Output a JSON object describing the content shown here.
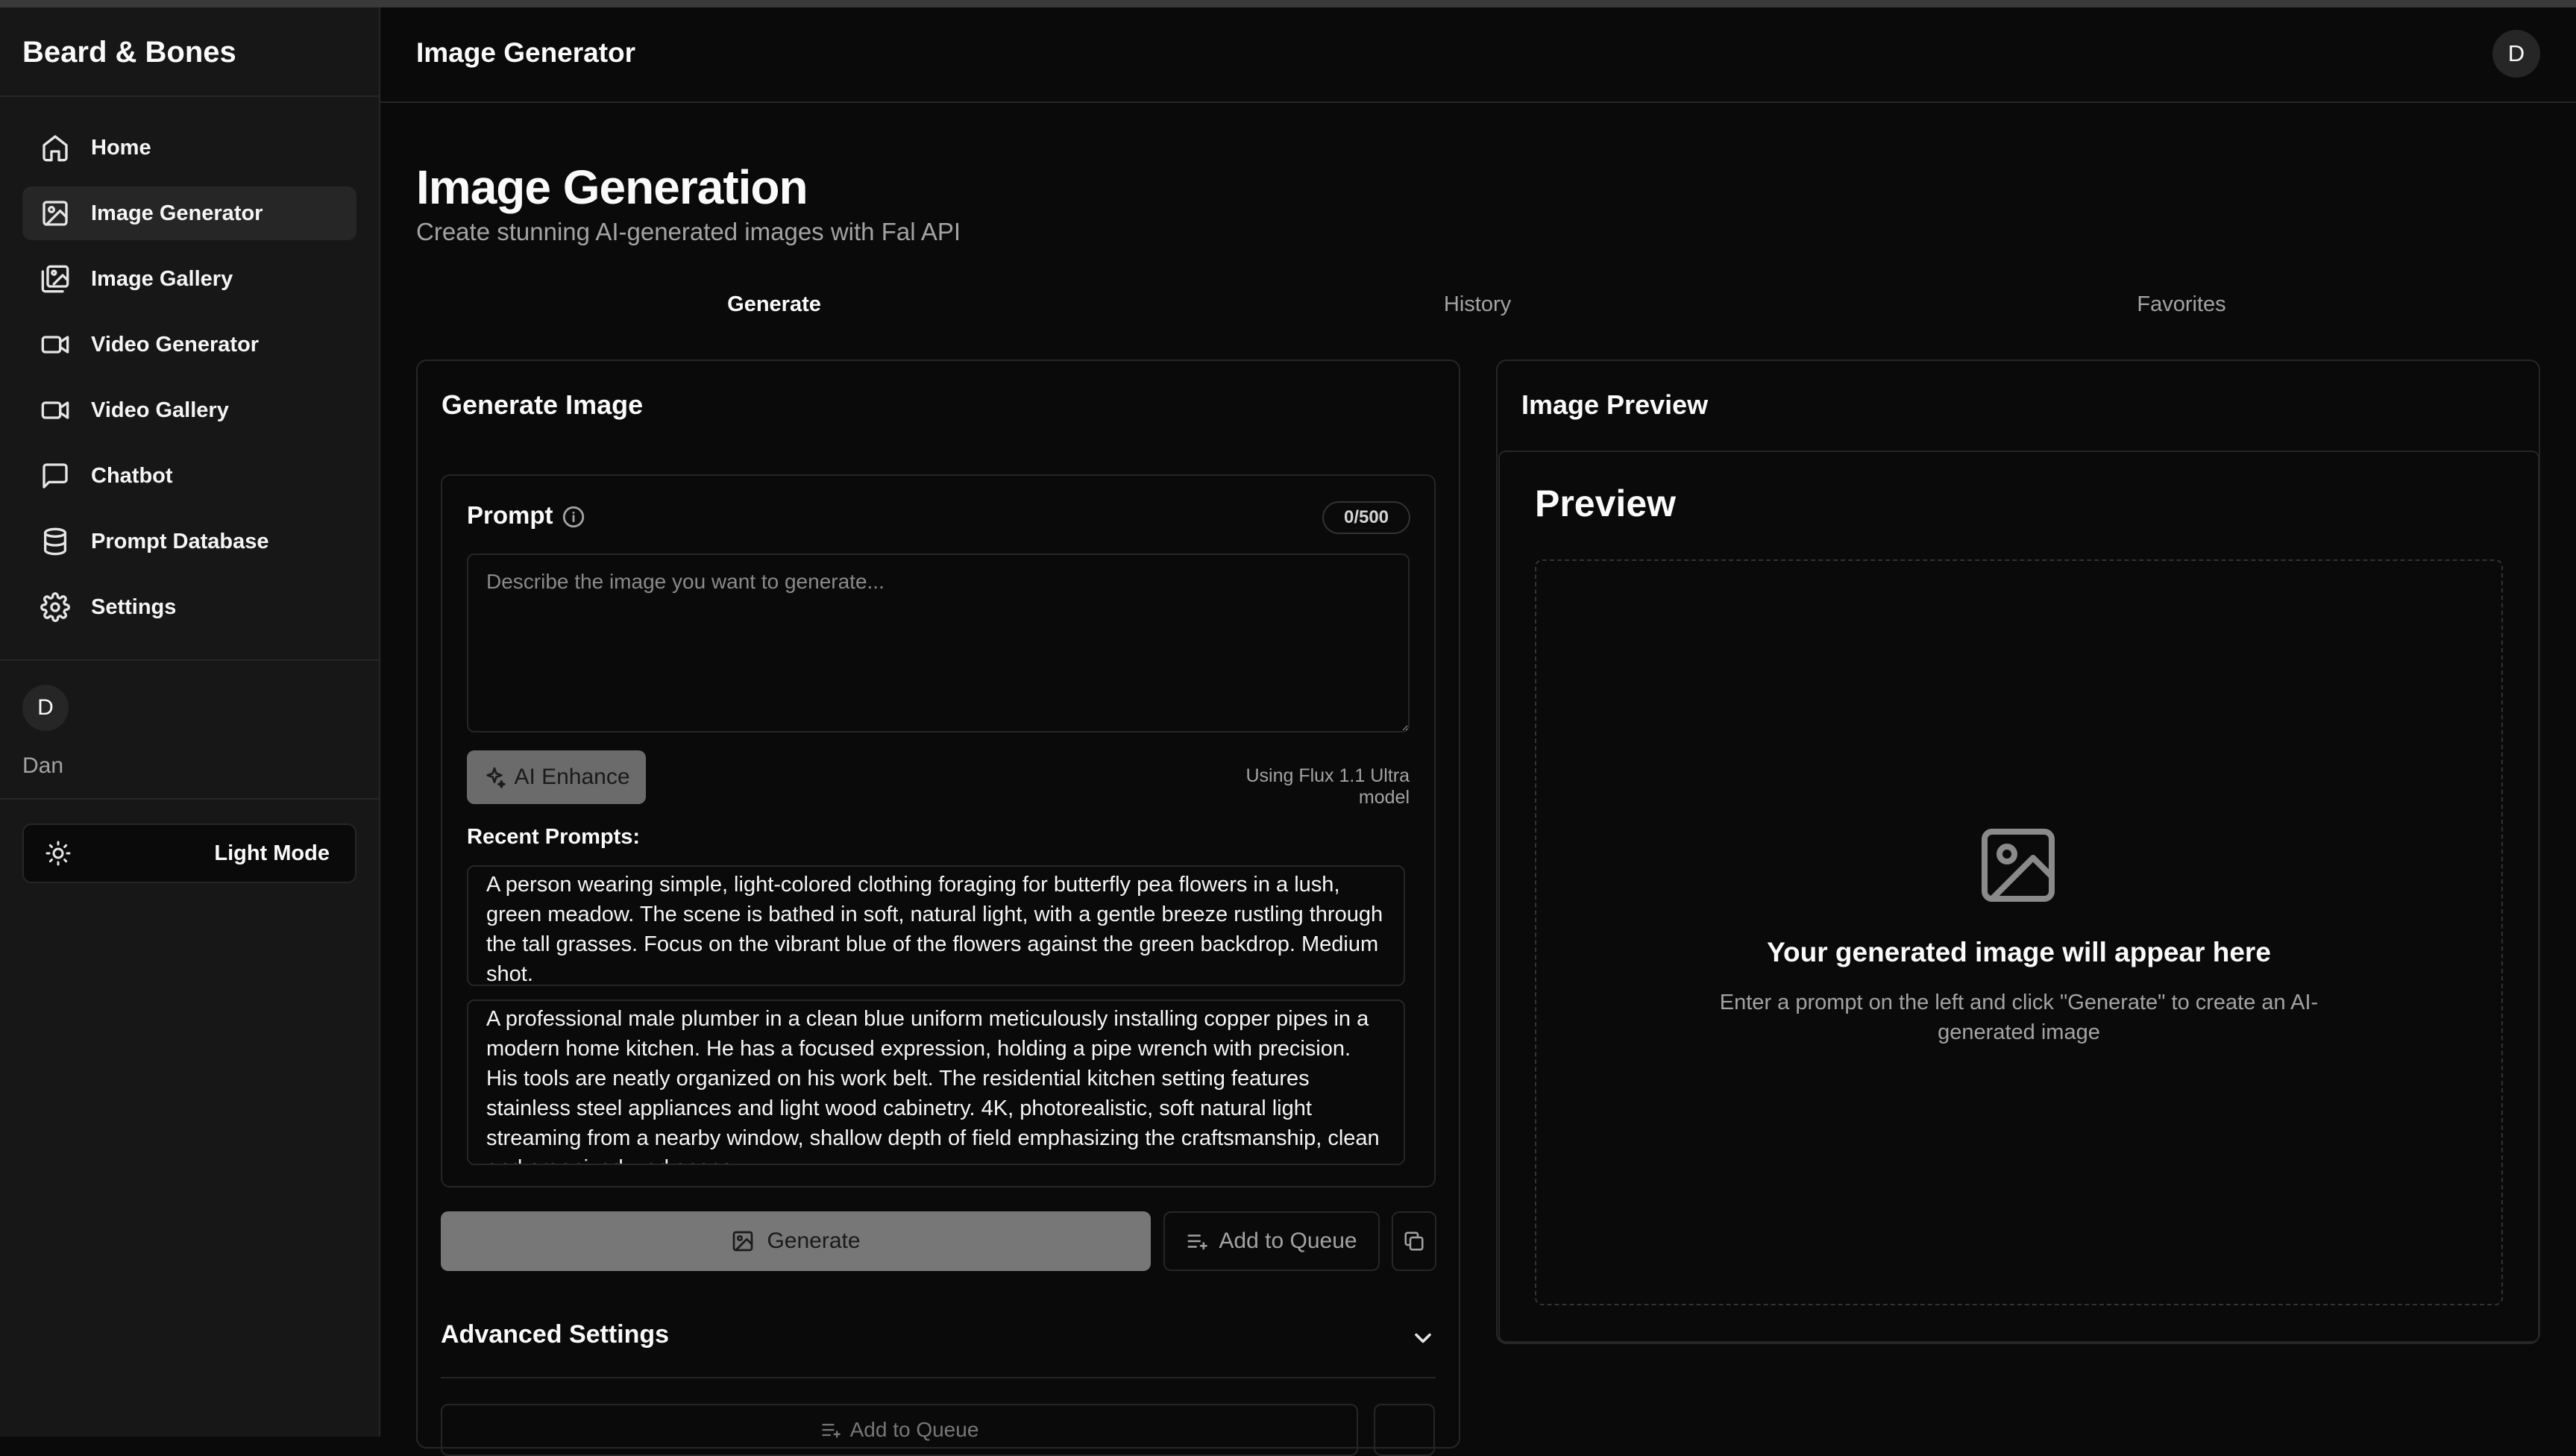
{
  "app": {
    "brand": "Beard & Bones"
  },
  "sidebar": {
    "items": [
      {
        "label": "Home",
        "icon": "home-icon",
        "active": false
      },
      {
        "label": "Image Generator",
        "icon": "image-icon",
        "active": true
      },
      {
        "label": "Image Gallery",
        "icon": "images-icon",
        "active": false
      },
      {
        "label": "Video Generator",
        "icon": "video-icon",
        "active": false
      },
      {
        "label": "Video Gallery",
        "icon": "video-icon",
        "active": false
      },
      {
        "label": "Chatbot",
        "icon": "chat-icon",
        "active": false
      },
      {
        "label": "Prompt Database",
        "icon": "database-icon",
        "active": false
      },
      {
        "label": "Settings",
        "icon": "gear-icon",
        "active": false
      }
    ],
    "user": {
      "initial": "D",
      "name": "Dan"
    },
    "mode_toggle": {
      "label": "Light Mode",
      "icon": "sun-icon"
    }
  },
  "header": {
    "title": "Image Generator",
    "avatar_initial": "D"
  },
  "page": {
    "title": "Image Generation",
    "subtitle": "Create stunning AI-generated images with Fal API"
  },
  "tabs": [
    {
      "label": "Generate",
      "active": true
    },
    {
      "label": "History",
      "active": false
    },
    {
      "label": "Favorites",
      "active": false
    }
  ],
  "generate_card": {
    "title": "Generate Image",
    "prompt_label": "Prompt",
    "counter": "0/500",
    "placeholder": "Describe the image you want to generate...",
    "value": "",
    "enhance_label": "AI Enhance",
    "model_note": "Using Flux 1.1 Ultra model",
    "recent_label": "Recent Prompts:",
    "recent_prompts": [
      "A person wearing simple, light-colored clothing foraging for butterfly pea flowers in a lush, green meadow. The scene is bathed in soft, natural light, with a gentle breeze rustling through the tall grasses. Focus on the vibrant blue of the flowers against the green backdrop. Medium shot.",
      "A professional male plumber in a clean blue uniform meticulously installing copper pipes in a modern home kitchen. He has a focused expression, holding a pipe wrench with precision. His tools are neatly organized on his work belt. The residential kitchen setting features stainless steel appliances and light wood cabinetry. 4K, photorealistic, soft natural light streaming from a nearby window, shallow depth of field emphasizing the craftsmanship, clean and organized workspace."
    ],
    "generate_label": "Generate",
    "queue_label": "Add to Queue",
    "advanced_label": "Advanced Settings",
    "ghost_queue_label": "Add to Queue"
  },
  "preview_card": {
    "title": "Image Preview",
    "heading": "Preview",
    "empty_title": "Your generated image will appear here",
    "empty_desc": "Enter a prompt on the left and click \"Generate\" to create an AI-generated image"
  },
  "colors": {
    "background": "#0a0a0a",
    "sidebar": "#171717",
    "border": "#262626",
    "muted_text": "#a3a3a3"
  }
}
